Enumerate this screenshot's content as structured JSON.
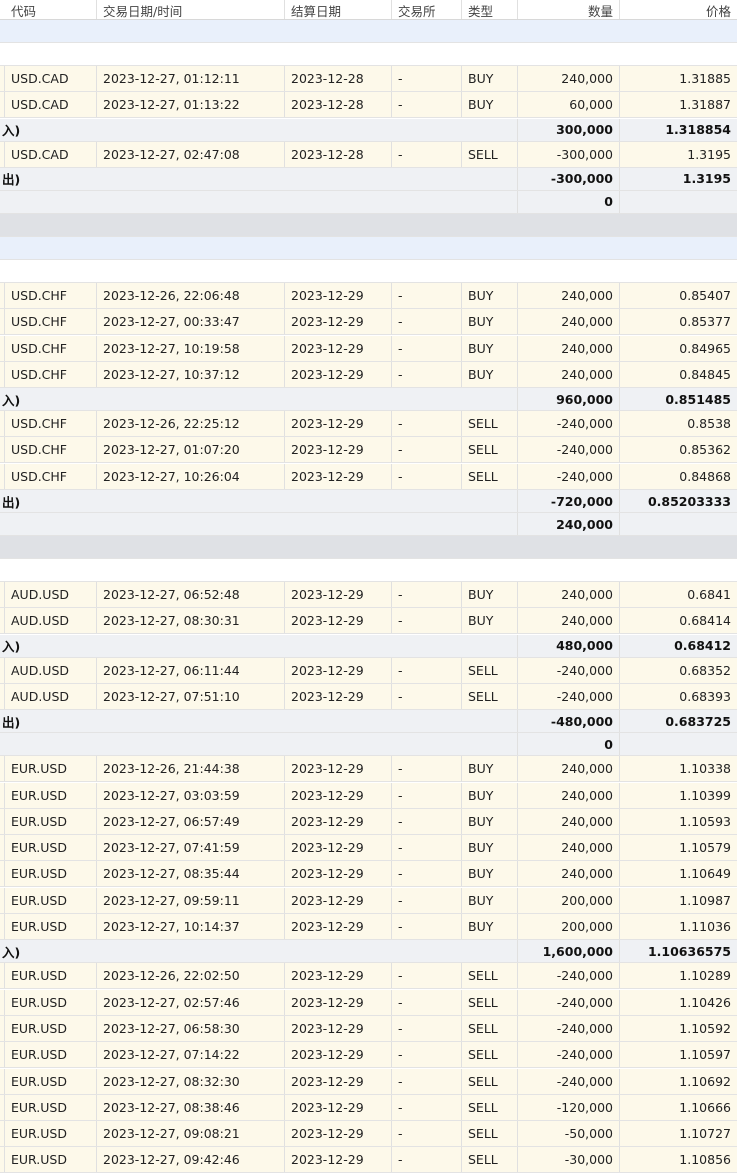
{
  "header": {
    "symbol_label": "代码",
    "datetime_label": "交易日期/时间",
    "settle_label": "结算日期",
    "exchange_label": "交易所",
    "type_label": "类型",
    "qty_label": "数量",
    "price_label": "价格"
  },
  "rows": [
    {
      "kind": "group"
    },
    {
      "kind": "spacer"
    },
    {
      "kind": "data",
      "symbol": "USD.CAD",
      "datetime": "2023-12-27, 01:12:11",
      "settle": "2023-12-28",
      "exchange": "-",
      "type": "BUY",
      "qty": "240,000",
      "price": "1.31885"
    },
    {
      "kind": "data",
      "symbol": "USD.CAD",
      "datetime": "2023-12-27, 01:13:22",
      "settle": "2023-12-28",
      "exchange": "-",
      "type": "BUY",
      "qty": "60,000",
      "price": "1.31887"
    },
    {
      "kind": "subtotal",
      "label": "入)",
      "qty": "300,000",
      "price": "1.318854"
    },
    {
      "kind": "data",
      "symbol": "USD.CAD",
      "datetime": "2023-12-27, 02:47:08",
      "settle": "2023-12-28",
      "exchange": "-",
      "type": "SELL",
      "qty": "-300,000",
      "price": "1.3195"
    },
    {
      "kind": "subtotal",
      "label": "出)",
      "qty": "-300,000",
      "price": "1.3195"
    },
    {
      "kind": "net",
      "qty": "0"
    },
    {
      "kind": "band"
    },
    {
      "kind": "group"
    },
    {
      "kind": "spacer"
    },
    {
      "kind": "data",
      "symbol": "USD.CHF",
      "datetime": "2023-12-26, 22:06:48",
      "settle": "2023-12-29",
      "exchange": "-",
      "type": "BUY",
      "qty": "240,000",
      "price": "0.85407"
    },
    {
      "kind": "data",
      "symbol": "USD.CHF",
      "datetime": "2023-12-27, 00:33:47",
      "settle": "2023-12-29",
      "exchange": "-",
      "type": "BUY",
      "qty": "240,000",
      "price": "0.85377"
    },
    {
      "kind": "data",
      "symbol": "USD.CHF",
      "datetime": "2023-12-27, 10:19:58",
      "settle": "2023-12-29",
      "exchange": "-",
      "type": "BUY",
      "qty": "240,000",
      "price": "0.84965"
    },
    {
      "kind": "data",
      "symbol": "USD.CHF",
      "datetime": "2023-12-27, 10:37:12",
      "settle": "2023-12-29",
      "exchange": "-",
      "type": "BUY",
      "qty": "240,000",
      "price": "0.84845"
    },
    {
      "kind": "subtotal",
      "label": "入)",
      "qty": "960,000",
      "price": "0.851485"
    },
    {
      "kind": "data",
      "symbol": "USD.CHF",
      "datetime": "2023-12-26, 22:25:12",
      "settle": "2023-12-29",
      "exchange": "-",
      "type": "SELL",
      "qty": "-240,000",
      "price": "0.8538"
    },
    {
      "kind": "data",
      "symbol": "USD.CHF",
      "datetime": "2023-12-27, 01:07:20",
      "settle": "2023-12-29",
      "exchange": "-",
      "type": "SELL",
      "qty": "-240,000",
      "price": "0.85362"
    },
    {
      "kind": "data",
      "symbol": "USD.CHF",
      "datetime": "2023-12-27, 10:26:04",
      "settle": "2023-12-29",
      "exchange": "-",
      "type": "SELL",
      "qty": "-240,000",
      "price": "0.84868"
    },
    {
      "kind": "subtotal",
      "label": "出)",
      "qty": "-720,000",
      "price": "0.85203333"
    },
    {
      "kind": "net",
      "qty": "240,000"
    },
    {
      "kind": "band"
    },
    {
      "kind": "spacer"
    },
    {
      "kind": "data",
      "symbol": "AUD.USD",
      "datetime": "2023-12-27, 06:52:48",
      "settle": "2023-12-29",
      "exchange": "-",
      "type": "BUY",
      "qty": "240,000",
      "price": "0.6841"
    },
    {
      "kind": "data",
      "symbol": "AUD.USD",
      "datetime": "2023-12-27, 08:30:31",
      "settle": "2023-12-29",
      "exchange": "-",
      "type": "BUY",
      "qty": "240,000",
      "price": "0.68414"
    },
    {
      "kind": "subtotal",
      "label": "入)",
      "qty": "480,000",
      "price": "0.68412"
    },
    {
      "kind": "data",
      "symbol": "AUD.USD",
      "datetime": "2023-12-27, 06:11:44",
      "settle": "2023-12-29",
      "exchange": "-",
      "type": "SELL",
      "qty": "-240,000",
      "price": "0.68352"
    },
    {
      "kind": "data",
      "symbol": "AUD.USD",
      "datetime": "2023-12-27, 07:51:10",
      "settle": "2023-12-29",
      "exchange": "-",
      "type": "SELL",
      "qty": "-240,000",
      "price": "0.68393"
    },
    {
      "kind": "subtotal",
      "label": "出)",
      "qty": "-480,000",
      "price": "0.683725"
    },
    {
      "kind": "net",
      "qty": "0"
    },
    {
      "kind": "data",
      "symbol": "EUR.USD",
      "datetime": "2023-12-26, 21:44:38",
      "settle": "2023-12-29",
      "exchange": "-",
      "type": "BUY",
      "qty": "240,000",
      "price": "1.10338"
    },
    {
      "kind": "data",
      "symbol": "EUR.USD",
      "datetime": "2023-12-27, 03:03:59",
      "settle": "2023-12-29",
      "exchange": "-",
      "type": "BUY",
      "qty": "240,000",
      "price": "1.10399"
    },
    {
      "kind": "data",
      "symbol": "EUR.USD",
      "datetime": "2023-12-27, 06:57:49",
      "settle": "2023-12-29",
      "exchange": "-",
      "type": "BUY",
      "qty": "240,000",
      "price": "1.10593"
    },
    {
      "kind": "data",
      "symbol": "EUR.USD",
      "datetime": "2023-12-27, 07:41:59",
      "settle": "2023-12-29",
      "exchange": "-",
      "type": "BUY",
      "qty": "240,000",
      "price": "1.10579"
    },
    {
      "kind": "data",
      "symbol": "EUR.USD",
      "datetime": "2023-12-27, 08:35:44",
      "settle": "2023-12-29",
      "exchange": "-",
      "type": "BUY",
      "qty": "240,000",
      "price": "1.10649"
    },
    {
      "kind": "data",
      "symbol": "EUR.USD",
      "datetime": "2023-12-27, 09:59:11",
      "settle": "2023-12-29",
      "exchange": "-",
      "type": "BUY",
      "qty": "200,000",
      "price": "1.10987"
    },
    {
      "kind": "data",
      "symbol": "EUR.USD",
      "datetime": "2023-12-27, 10:14:37",
      "settle": "2023-12-29",
      "exchange": "-",
      "type": "BUY",
      "qty": "200,000",
      "price": "1.11036"
    },
    {
      "kind": "subtotal",
      "label": "入)",
      "qty": "1,600,000",
      "price": "1.10636575"
    },
    {
      "kind": "data",
      "symbol": "EUR.USD",
      "datetime": "2023-12-26, 22:02:50",
      "settle": "2023-12-29",
      "exchange": "-",
      "type": "SELL",
      "qty": "-240,000",
      "price": "1.10289"
    },
    {
      "kind": "data",
      "symbol": "EUR.USD",
      "datetime": "2023-12-27, 02:57:46",
      "settle": "2023-12-29",
      "exchange": "-",
      "type": "SELL",
      "qty": "-240,000",
      "price": "1.10426"
    },
    {
      "kind": "data",
      "symbol": "EUR.USD",
      "datetime": "2023-12-27, 06:58:30",
      "settle": "2023-12-29",
      "exchange": "-",
      "type": "SELL",
      "qty": "-240,000",
      "price": "1.10592"
    },
    {
      "kind": "data",
      "symbol": "EUR.USD",
      "datetime": "2023-12-27, 07:14:22",
      "settle": "2023-12-29",
      "exchange": "-",
      "type": "SELL",
      "qty": "-240,000",
      "price": "1.10597"
    },
    {
      "kind": "data",
      "symbol": "EUR.USD",
      "datetime": "2023-12-27, 08:32:30",
      "settle": "2023-12-29",
      "exchange": "-",
      "type": "SELL",
      "qty": "-240,000",
      "price": "1.10692"
    },
    {
      "kind": "data",
      "symbol": "EUR.USD",
      "datetime": "2023-12-27, 08:38:46",
      "settle": "2023-12-29",
      "exchange": "-",
      "type": "SELL",
      "qty": "-120,000",
      "price": "1.10666"
    },
    {
      "kind": "data",
      "symbol": "EUR.USD",
      "datetime": "2023-12-27, 09:08:21",
      "settle": "2023-12-29",
      "exchange": "-",
      "type": "SELL",
      "qty": "-50,000",
      "price": "1.10727"
    },
    {
      "kind": "data",
      "symbol": "EUR.USD",
      "datetime": "2023-12-27, 09:42:46",
      "settle": "2023-12-29",
      "exchange": "-",
      "type": "SELL",
      "qty": "-30,000",
      "price": "1.10856"
    }
  ]
}
